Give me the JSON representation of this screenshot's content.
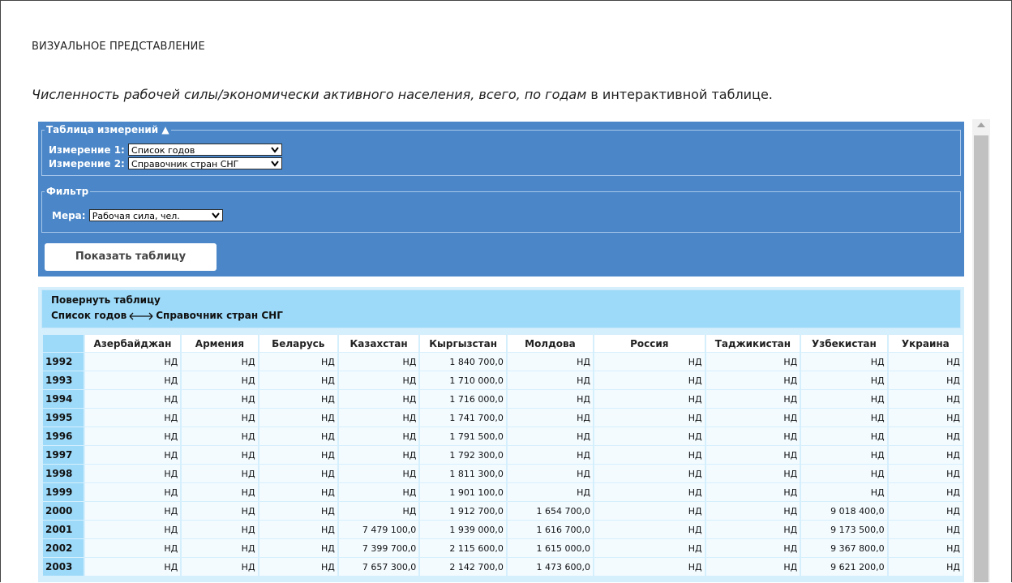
{
  "section_title": "ВИЗУАЛЬНОЕ ПРЕДСТАВЛЕНИЕ",
  "intro": {
    "emphasis": "Численность рабочей силы/экономически активного населения, всего, по годам",
    "rest": " в интерактивной таблице."
  },
  "dimensions": {
    "legend": "Таблица измерений ▲",
    "dim1_label": "Измерение 1:",
    "dim1_value": "Список годов",
    "dim2_label": "Измерение 2:",
    "dim2_value": "Справочник стран СНГ"
  },
  "filter": {
    "legend": "Фильтр",
    "measure_label": "Мера:",
    "measure_value": "Рабочая сила, чел."
  },
  "show_button": "Показать таблицу",
  "pivot": {
    "title": "Повернуть таблицу",
    "left": "Список годов",
    "right": "Справочник стран СНГ"
  },
  "table": {
    "columns": [
      "Азербайджан",
      "Армения",
      "Беларусь",
      "Казахстан",
      "Кыргызстан",
      "Молдова",
      "Россия",
      "Таджикистан",
      "Узбекистан",
      "Украина"
    ],
    "rows": [
      {
        "year": "1992",
        "cells": [
          "НД",
          "НД",
          "НД",
          "НД",
          "1 840 700,0",
          "НД",
          "НД",
          "НД",
          "НД",
          "НД"
        ]
      },
      {
        "year": "1993",
        "cells": [
          "НД",
          "НД",
          "НД",
          "НД",
          "1 710 000,0",
          "НД",
          "НД",
          "НД",
          "НД",
          "НД"
        ]
      },
      {
        "year": "1994",
        "cells": [
          "НД",
          "НД",
          "НД",
          "НД",
          "1 716 000,0",
          "НД",
          "НД",
          "НД",
          "НД",
          "НД"
        ]
      },
      {
        "year": "1995",
        "cells": [
          "НД",
          "НД",
          "НД",
          "НД",
          "1 741 700,0",
          "НД",
          "НД",
          "НД",
          "НД",
          "НД"
        ]
      },
      {
        "year": "1996",
        "cells": [
          "НД",
          "НД",
          "НД",
          "НД",
          "1 791 500,0",
          "НД",
          "НД",
          "НД",
          "НД",
          "НД"
        ]
      },
      {
        "year": "1997",
        "cells": [
          "НД",
          "НД",
          "НД",
          "НД",
          "1 792 300,0",
          "НД",
          "НД",
          "НД",
          "НД",
          "НД"
        ]
      },
      {
        "year": "1998",
        "cells": [
          "НД",
          "НД",
          "НД",
          "НД",
          "1 811 300,0",
          "НД",
          "НД",
          "НД",
          "НД",
          "НД"
        ]
      },
      {
        "year": "1999",
        "cells": [
          "НД",
          "НД",
          "НД",
          "НД",
          "1 901 100,0",
          "НД",
          "НД",
          "НД",
          "НД",
          "НД"
        ]
      },
      {
        "year": "2000",
        "cells": [
          "НД",
          "НД",
          "НД",
          "НД",
          "1 912 700,0",
          "1 654 700,0",
          "НД",
          "НД",
          "9 018 400,0",
          "НД"
        ]
      },
      {
        "year": "2001",
        "cells": [
          "НД",
          "НД",
          "НД",
          "7 479 100,0",
          "1 939 000,0",
          "1 616 700,0",
          "НД",
          "НД",
          "9 173 500,0",
          "НД"
        ]
      },
      {
        "year": "2002",
        "cells": [
          "НД",
          "НД",
          "НД",
          "7 399 700,0",
          "2 115 600,0",
          "1 615 000,0",
          "НД",
          "НД",
          "9 367 800,0",
          "НД"
        ]
      },
      {
        "year": "2003",
        "cells": [
          "НД",
          "НД",
          "НД",
          "7 657 300,0",
          "2 142 700,0",
          "1 473 600,0",
          "НД",
          "НД",
          "9 621 200,0",
          "НД"
        ]
      }
    ]
  },
  "colors": {
    "panel": "#4a86c8",
    "table_bg": "#d6effd",
    "header_accent": "#9ddaf9"
  }
}
